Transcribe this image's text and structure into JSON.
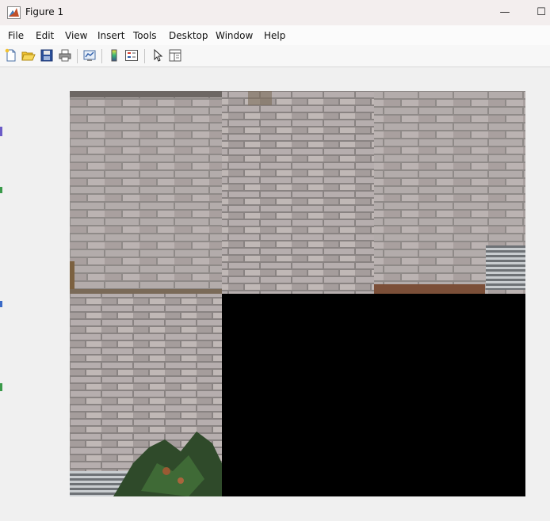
{
  "window": {
    "title": "Figure 1",
    "minimize_glyph": "—",
    "maximize_glyph": "☐"
  },
  "menu": [
    "File",
    "Edit",
    "View",
    "Insert",
    "Tools",
    "Desktop",
    "Window",
    "Help"
  ],
  "toolbar": {
    "buttons": [
      "new-figure-icon",
      "open-file-icon",
      "save-icon",
      "print-icon",
      "link-plot-icon",
      "insert-colorbar-icon",
      "insert-legend-icon",
      "edit-plot-arrow-icon",
      "property-inspector-icon"
    ]
  },
  "figure": {
    "image_grid": {
      "rows": 2,
      "cols": 3,
      "filled_tiles": 4,
      "empty_tile_color": "#000000"
    },
    "content": "brick-wall mosaic"
  },
  "colors": {
    "titlebar": "#f3eeee",
    "menubar": "#fbfbfb",
    "figure_bg": "#f0f0f0",
    "empty_tile": "#000000"
  }
}
